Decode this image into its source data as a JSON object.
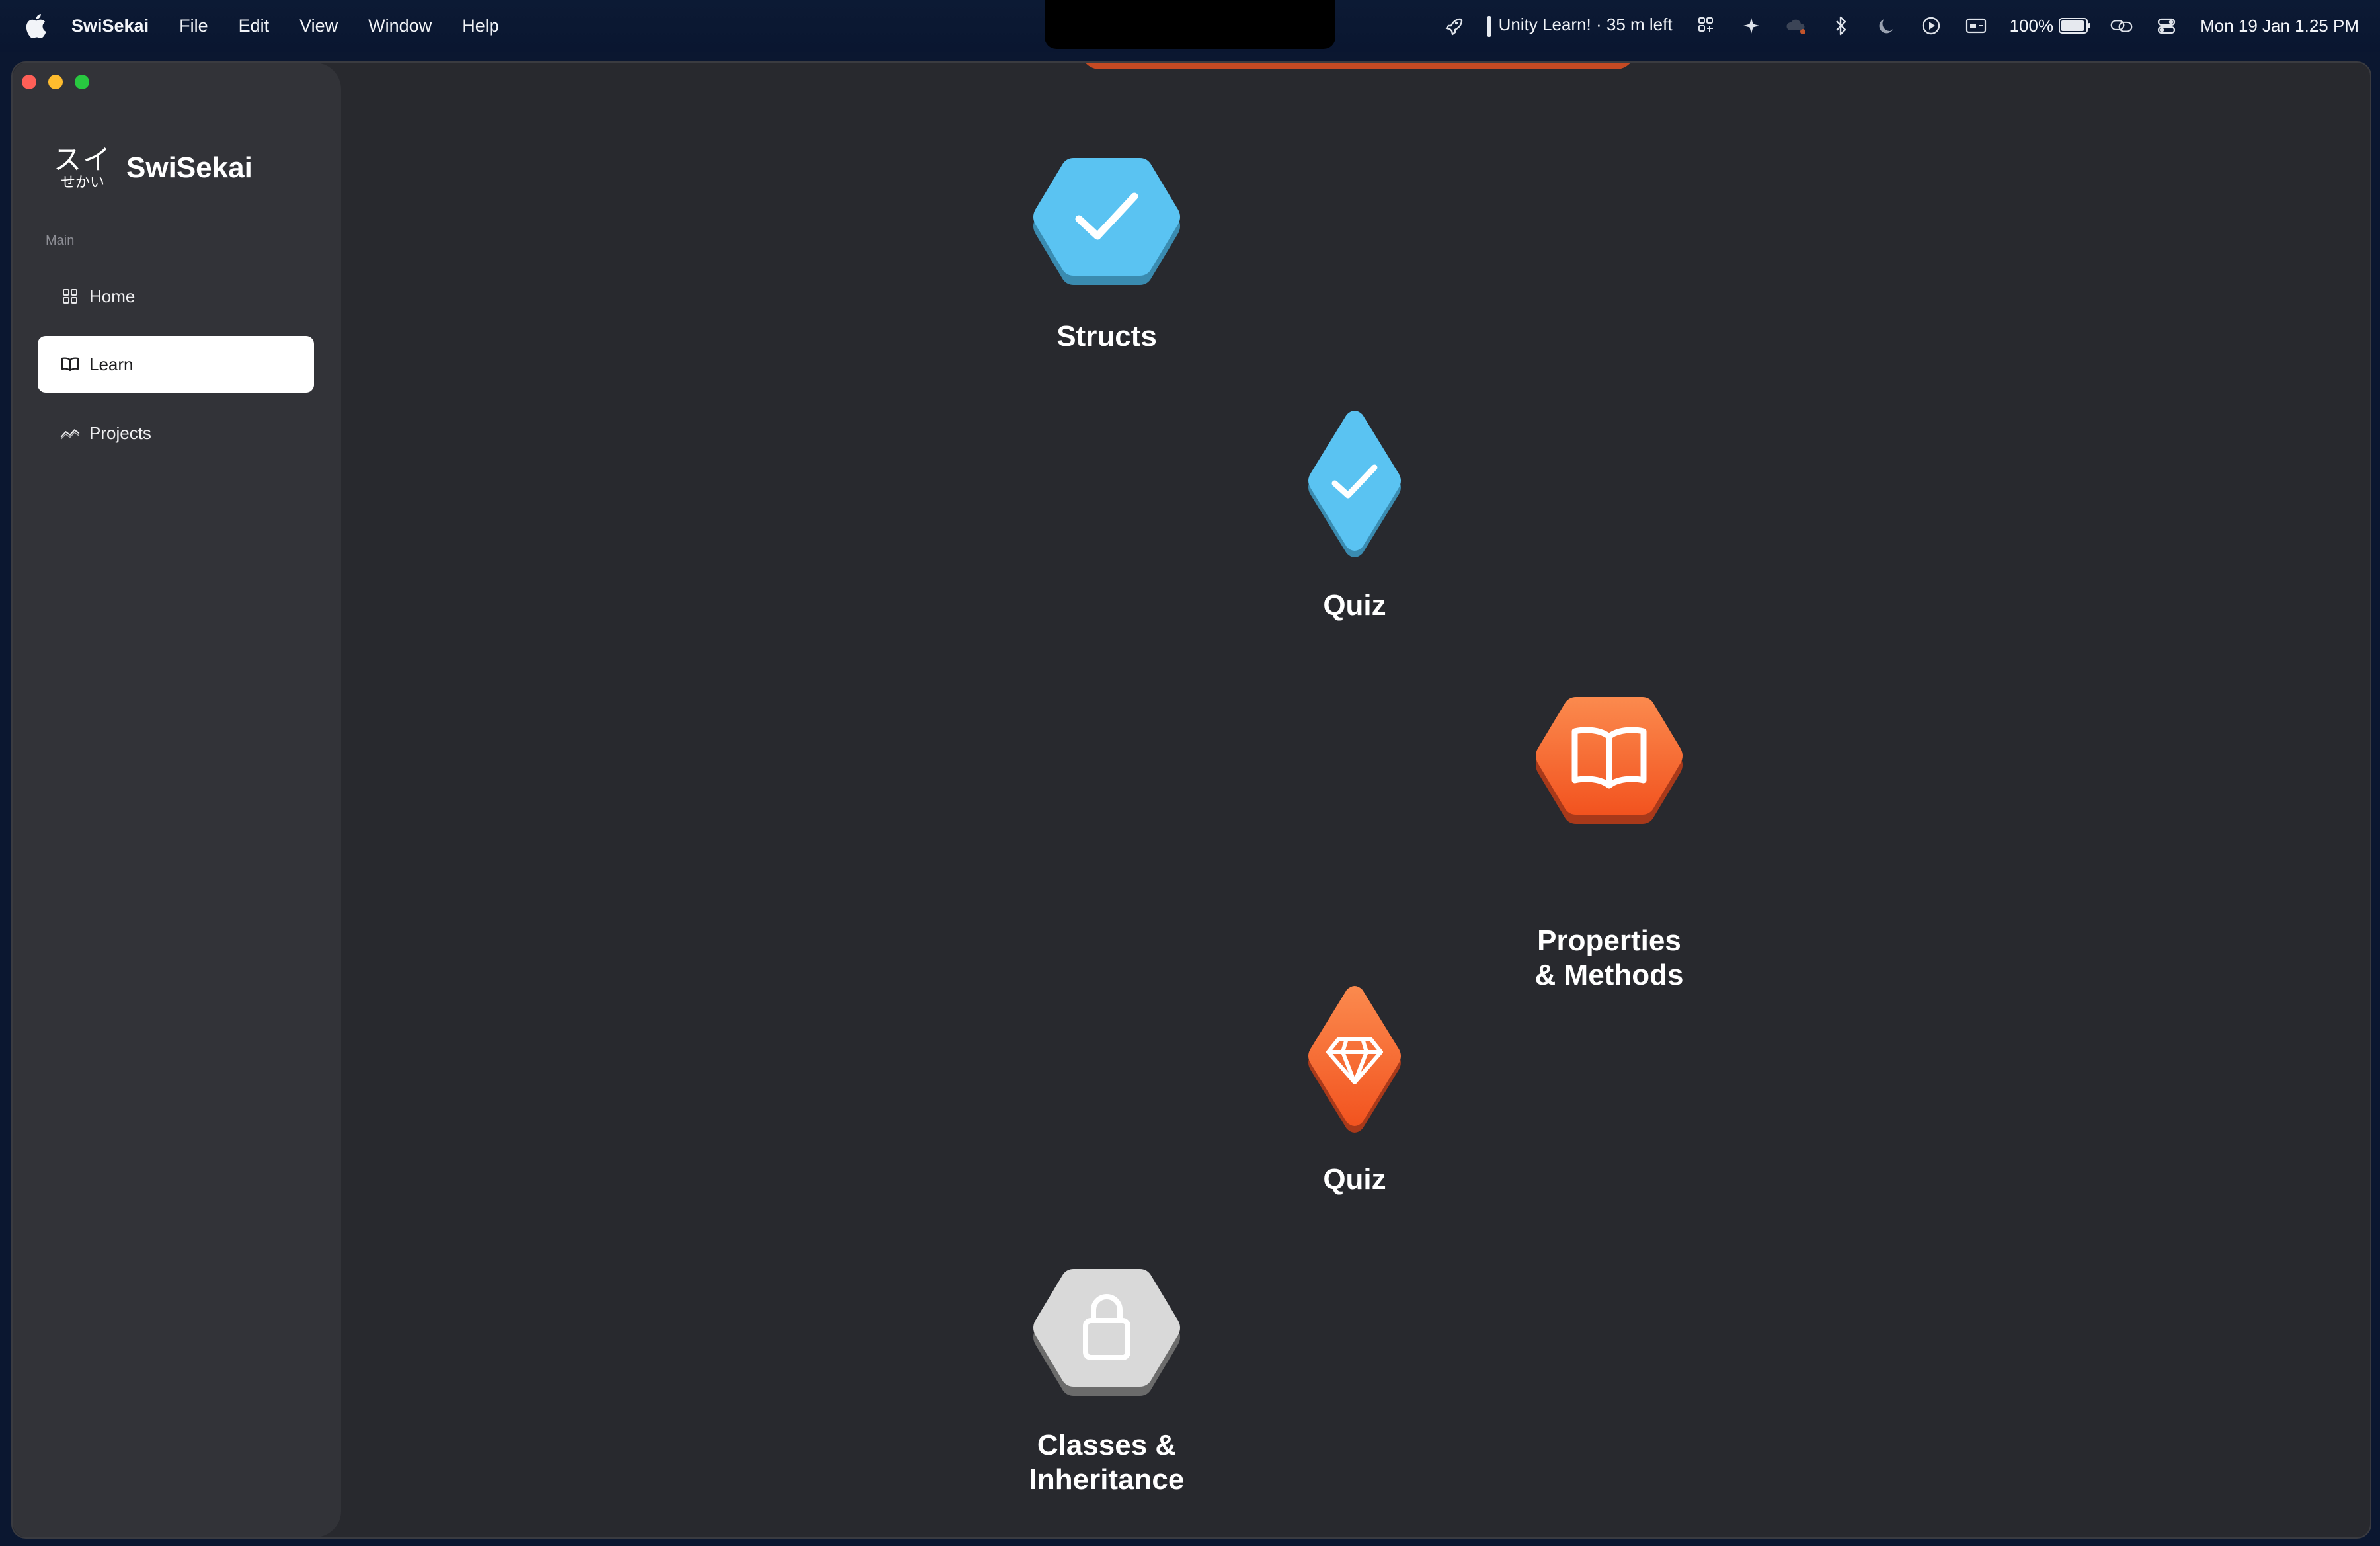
{
  "menubar": {
    "app_name": "SwiSekai",
    "menus": [
      "File",
      "Edit",
      "View",
      "Window",
      "Help"
    ],
    "timer_text": "Unity Learn! · 35 m left",
    "battery_percent_label": "100%",
    "battery_level": 1.0,
    "datetime": "Mon 19 Jan  1.25 PM"
  },
  "sidebar": {
    "logo_jp": "スイ",
    "logo_kana": "せかい",
    "app_title": "SwiSekai",
    "section": "Main",
    "items": [
      {
        "label": "Home",
        "icon": "grid-icon",
        "active": false
      },
      {
        "label": "Learn",
        "icon": "book-icon",
        "active": true
      },
      {
        "label": "Projects",
        "icon": "trend-icon",
        "active": false
      }
    ]
  },
  "path": {
    "nodes": [
      {
        "label": "Structs",
        "shape": "hexagon",
        "state": "completed",
        "icon": "checkmark-icon"
      },
      {
        "label": "Quiz",
        "shape": "diamond",
        "state": "completed",
        "icon": "checkmark-icon"
      },
      {
        "label": "Properties\n& Methods",
        "shape": "hexagon",
        "state": "current",
        "icon": "book-icon"
      },
      {
        "label": "Quiz",
        "shape": "diamond",
        "state": "current",
        "icon": "gem-icon"
      },
      {
        "label": "Classes &\nInheritance",
        "shape": "hexagon",
        "state": "locked",
        "icon": "lock-icon"
      }
    ]
  },
  "colors": {
    "completed": "#5ac3f2",
    "completed_shadow": "#3a8bb0",
    "current": "#f4602a",
    "current_shadow": "#a8391a",
    "locked": "#d9d9d9",
    "locked_shadow": "#6b6b6b",
    "window_bg": "#28292e",
    "sidebar_bg": "#323338"
  }
}
